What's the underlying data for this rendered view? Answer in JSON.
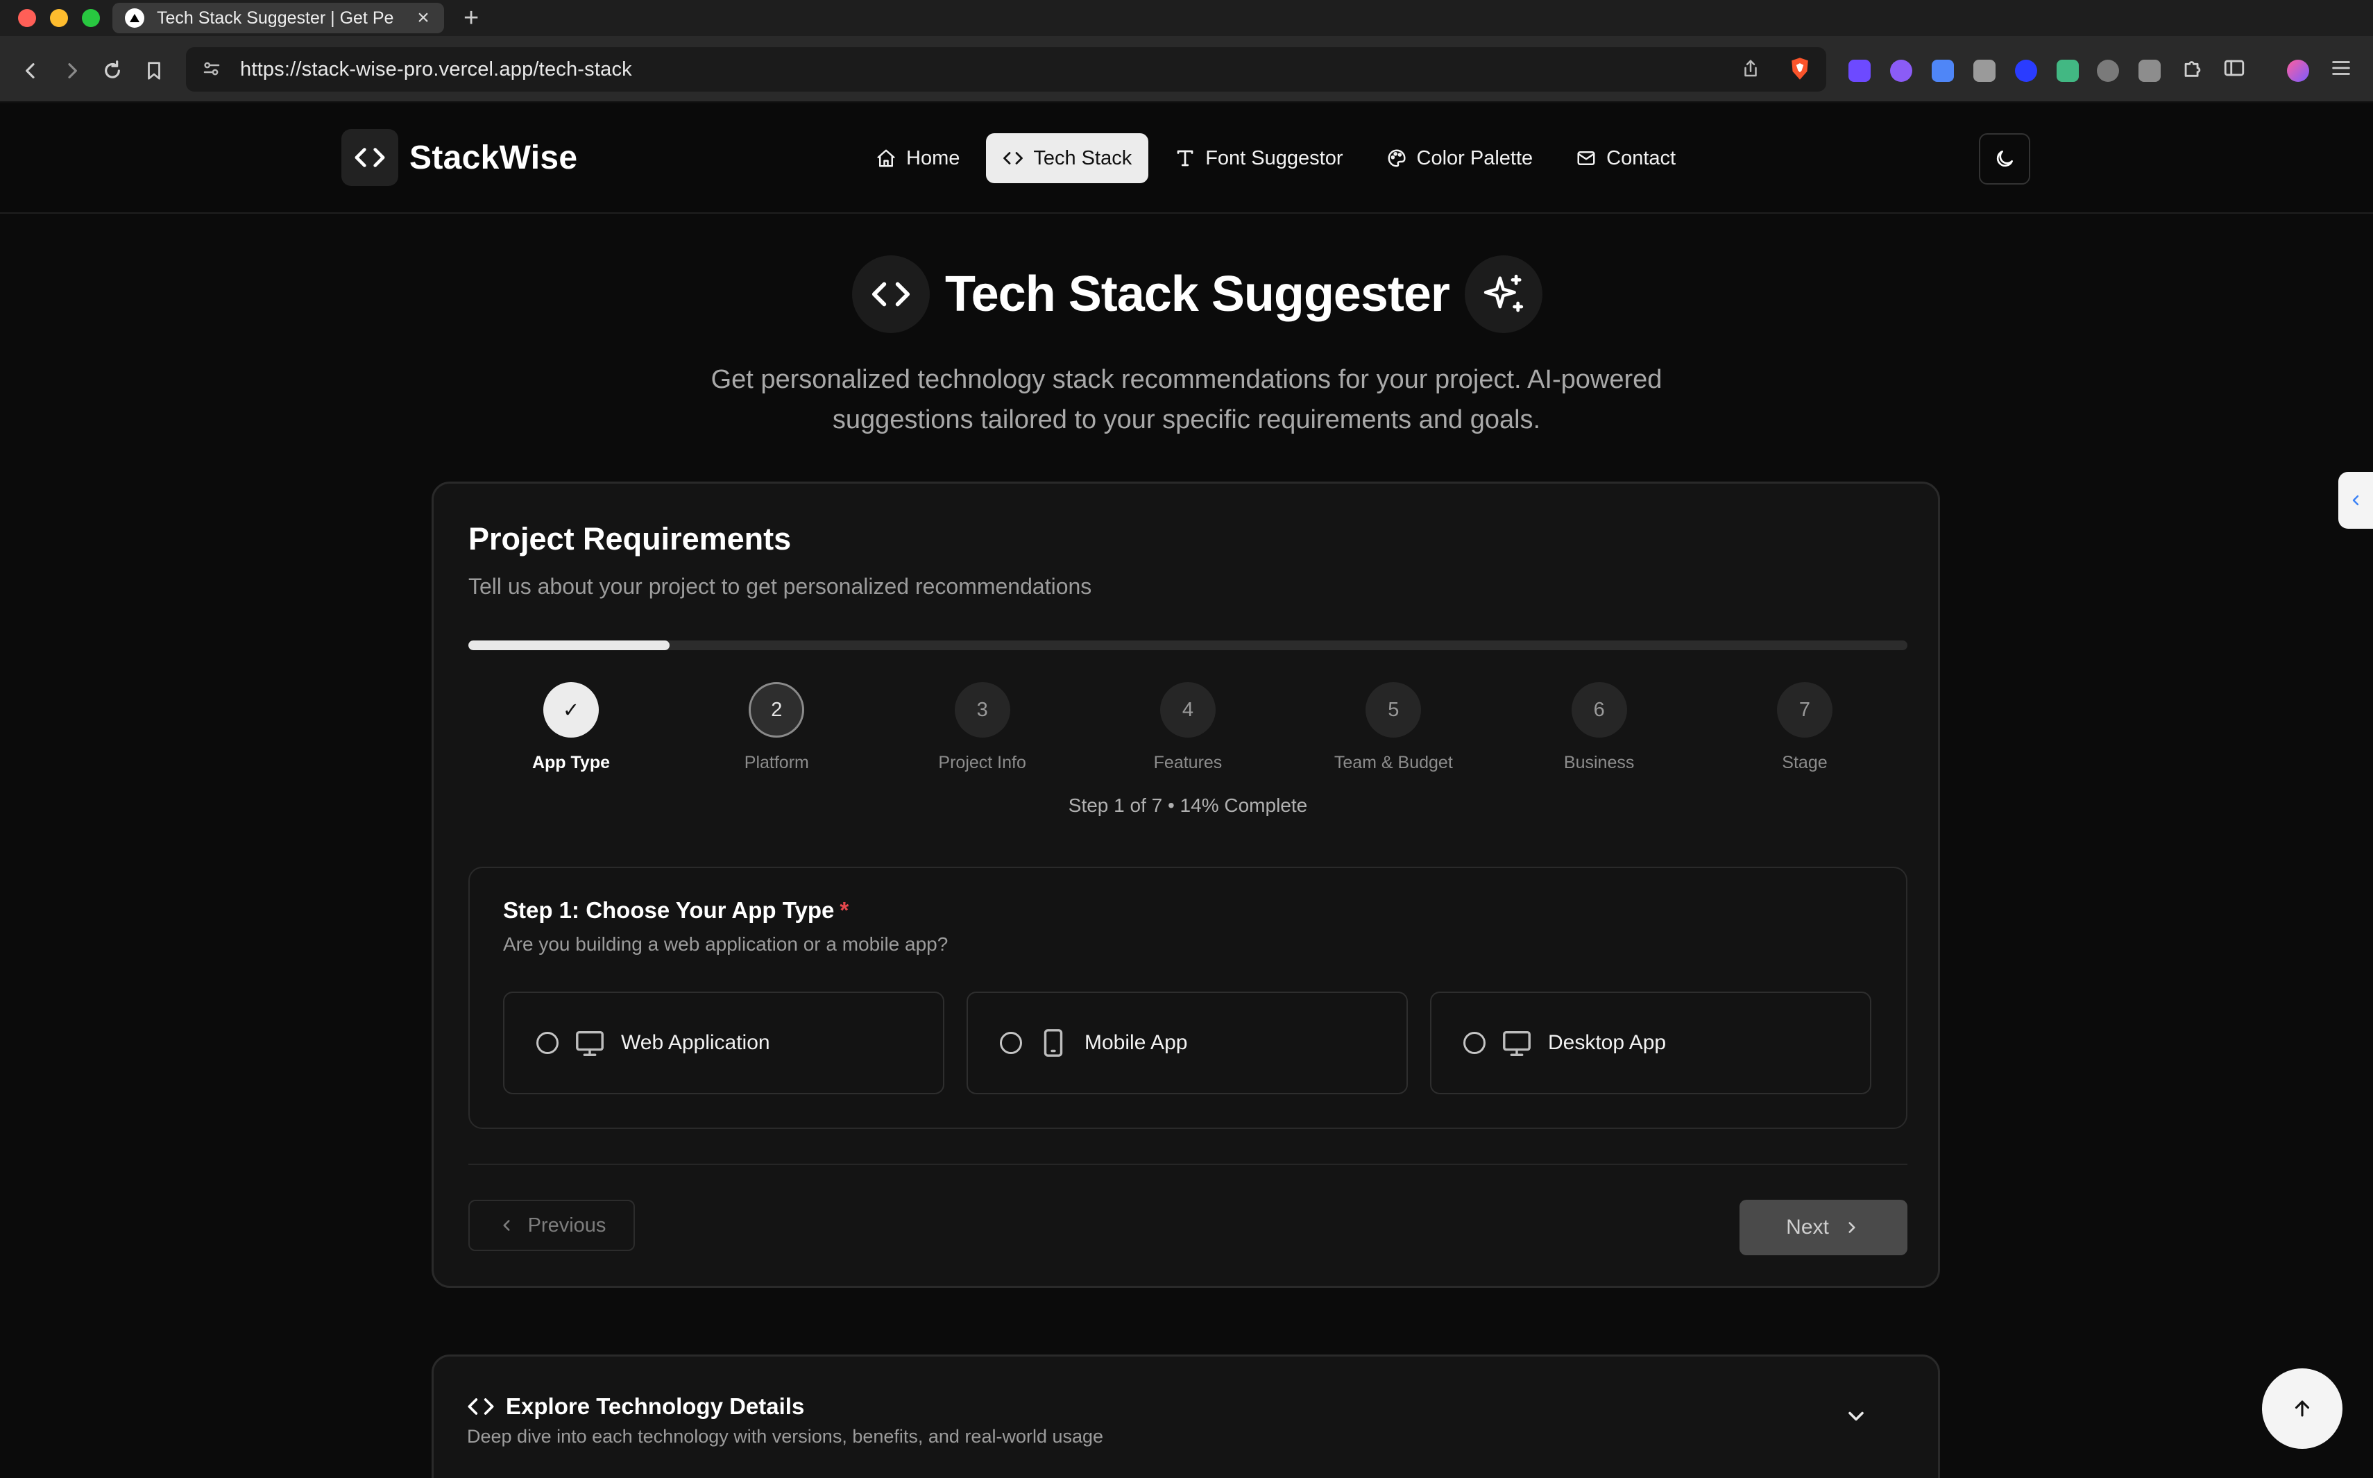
{
  "browser": {
    "tab_title": "Tech Stack Suggester | Get Pe",
    "url": "https://stack-wise-pro.vercel.app/tech-stack"
  },
  "header": {
    "logo": "StackWise",
    "nav": [
      {
        "label": "Home",
        "icon": "home-icon",
        "active": false
      },
      {
        "label": "Tech Stack",
        "icon": "code-icon",
        "active": true
      },
      {
        "label": "Font Suggestor",
        "icon": "type-icon",
        "active": false
      },
      {
        "label": "Color Palette",
        "icon": "palette-icon",
        "active": false
      },
      {
        "label": "Contact",
        "icon": "mail-icon",
        "active": false
      }
    ]
  },
  "hero": {
    "title": "Tech Stack Suggester",
    "subtitle": "Get personalized technology stack recommendations for your project. AI-powered suggestions tailored to your specific requirements and goals."
  },
  "card": {
    "title": "Project Requirements",
    "subtitle": "Tell us about your project to get personalized recommendations",
    "progress_percent": 14,
    "steps": [
      {
        "num": "✓",
        "label": "App Type",
        "state": "done"
      },
      {
        "num": "2",
        "label": "Platform",
        "state": "next"
      },
      {
        "num": "3",
        "label": "Project Info",
        "state": "pending"
      },
      {
        "num": "4",
        "label": "Features",
        "state": "pending"
      },
      {
        "num": "5",
        "label": "Team & Budget",
        "state": "pending"
      },
      {
        "num": "6",
        "label": "Business",
        "state": "pending"
      },
      {
        "num": "7",
        "label": "Stage",
        "state": "pending"
      }
    ],
    "status": "Step 1 of 7 • 14% Complete",
    "question": "Step 1: Choose Your App Type",
    "required_mark": "*",
    "hint": "Are you building a web application or a mobile app?",
    "options": [
      {
        "label": "Web Application",
        "icon": "monitor-icon"
      },
      {
        "label": "Mobile App",
        "icon": "smartphone-icon"
      },
      {
        "label": "Desktop App",
        "icon": "monitor-icon"
      }
    ],
    "previous_label": "Previous",
    "next_label": "Next"
  },
  "explore": {
    "title": "Explore Technology Details",
    "subtitle": "Deep dive into each technology with versions, benefits, and real-world usage"
  },
  "colors": {
    "background": "#0b0b0b",
    "card": "#141414",
    "accent": "#ececec",
    "required": "#e5484d"
  }
}
